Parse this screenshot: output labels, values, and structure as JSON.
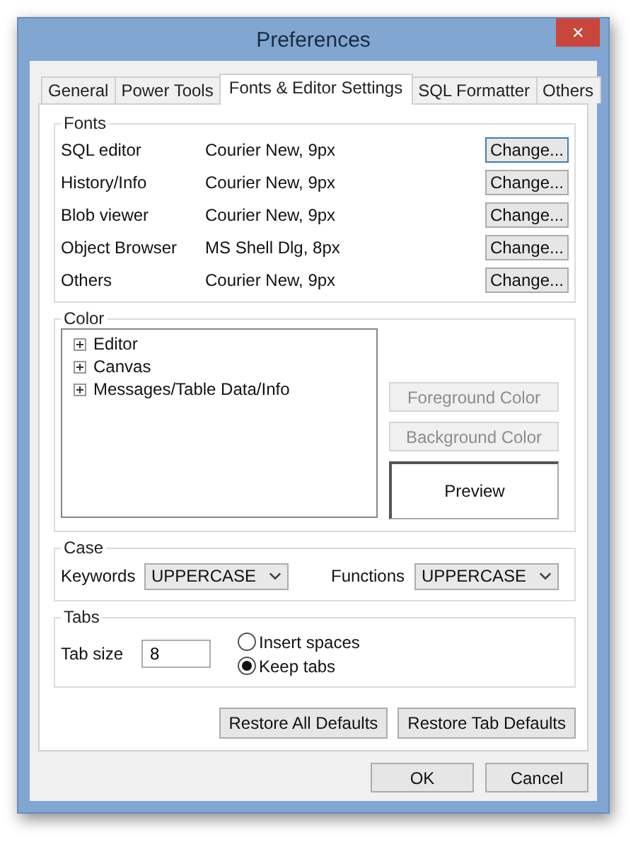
{
  "window": {
    "title": "Preferences",
    "close": "✕"
  },
  "tabs": [
    {
      "label": "General",
      "selected": false
    },
    {
      "label": "Power Tools",
      "selected": false
    },
    {
      "label": "Fonts & Editor Settings",
      "selected": true
    },
    {
      "label": "SQL Formatter",
      "selected": false
    },
    {
      "label": "Others",
      "selected": false
    }
  ],
  "fonts": {
    "title": "Fonts",
    "rows": [
      {
        "name": "SQL editor",
        "font": "Courier New, 9px",
        "button": "Change...",
        "focused": true
      },
      {
        "name": "History/Info",
        "font": "Courier New, 9px",
        "button": "Change...",
        "focused": false
      },
      {
        "name": "Blob viewer",
        "font": "Courier New, 9px",
        "button": "Change...",
        "focused": false
      },
      {
        "name": "Object Browser",
        "font": "MS Shell Dlg, 8px",
        "button": "Change...",
        "focused": false
      },
      {
        "name": "Others",
        "font": "Courier New, 9px",
        "button": "Change...",
        "focused": false
      }
    ]
  },
  "color": {
    "title": "Color",
    "tree": [
      {
        "label": "Editor",
        "expanded": false
      },
      {
        "label": "Canvas",
        "expanded": false
      },
      {
        "label": "Messages/Table Data/Info",
        "expanded": false
      }
    ],
    "buttons": [
      {
        "label": "Foreground Color",
        "disabled": true
      },
      {
        "label": "Background Color",
        "disabled": true
      }
    ],
    "preview": "Preview"
  },
  "case": {
    "title": "Case",
    "fields": [
      {
        "label": "Keywords",
        "value": "UPPERCASE"
      },
      {
        "label": "Functions",
        "value": "UPPERCASE"
      }
    ]
  },
  "tab_settings": {
    "title": "Tabs",
    "size_label": "Tab size",
    "size": "8",
    "options": [
      {
        "label": "Insert spaces",
        "selected": false
      },
      {
        "label": "Keep tabs",
        "selected": true
      }
    ]
  },
  "restore_buttons": [
    "Restore All Defaults",
    "Restore Tab Defaults"
  ],
  "buttons": [
    "OK",
    "Cancel"
  ]
}
